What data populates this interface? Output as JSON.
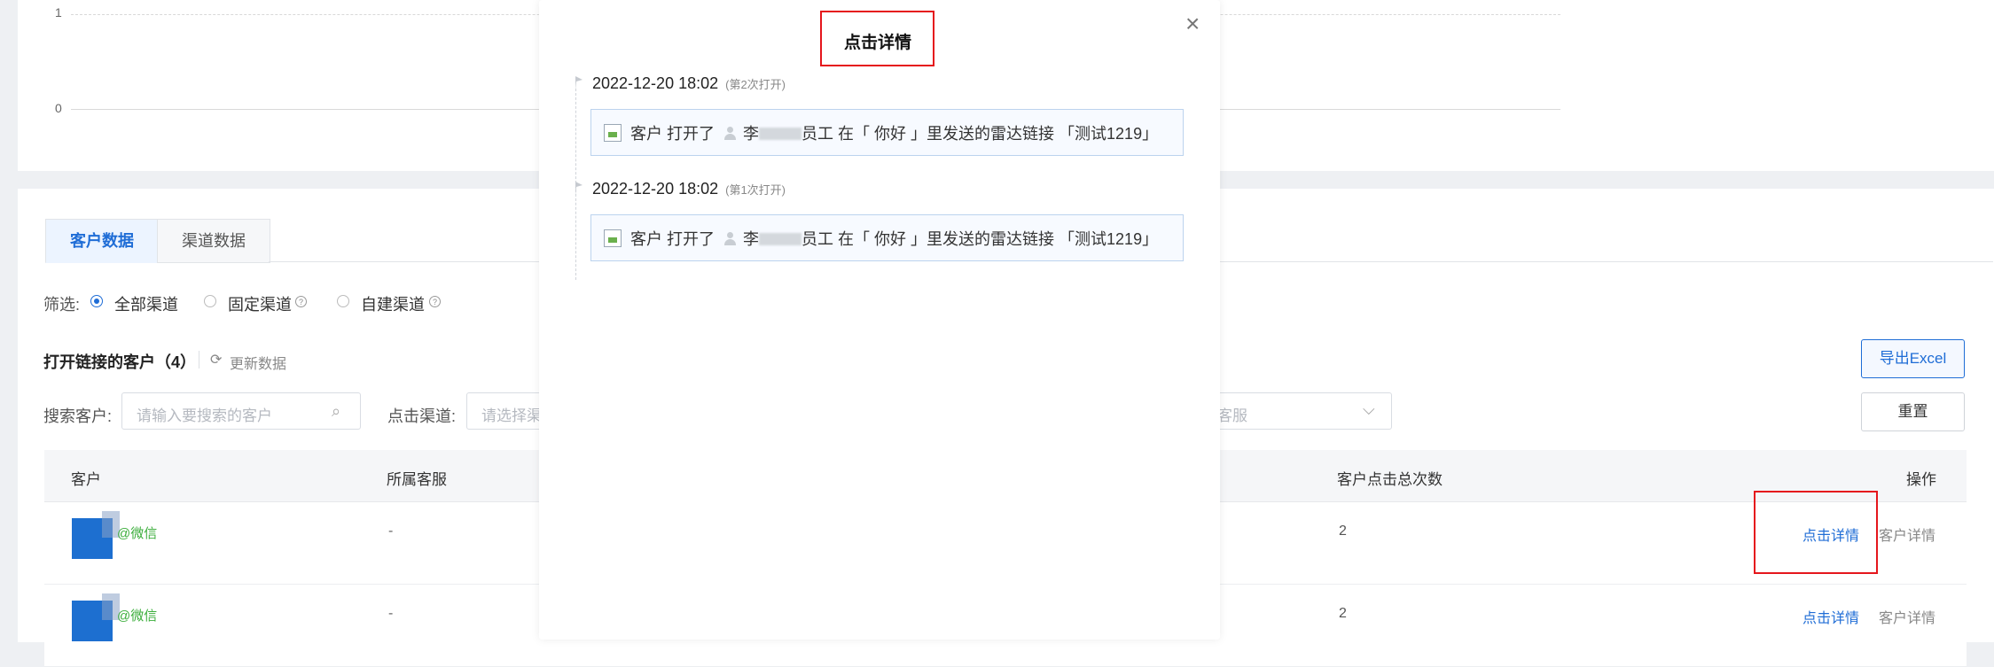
{
  "chart": {
    "ticks": [
      "1",
      "0"
    ]
  },
  "tabs": {
    "customer_data": "客户数据",
    "channel_data": "渠道数据"
  },
  "filter": {
    "label": "筛选:",
    "options": [
      "全部渠道",
      "固定渠道",
      "自建渠道"
    ],
    "selected": "全部渠道"
  },
  "section": {
    "title": "打开链接的客户（4）",
    "refresh": "更新数据",
    "export_button": "导出Excel"
  },
  "search": {
    "customer_label": "搜索客户:",
    "customer_placeholder": "请输入要搜索的客户",
    "channel_label": "点击渠道:",
    "channel_placeholder": "请选择渠",
    "staff_placeholder": "客服",
    "reset_button": "重置"
  },
  "table": {
    "columns": {
      "customer": "客户",
      "staff": "所属客服",
      "clicks": "客户点击总次数",
      "actions": "操作"
    },
    "rows": [
      {
        "tag": "@微信",
        "staff": "-",
        "clicks": "2",
        "detail_link": "点击详情",
        "customer_link": "客户详情"
      },
      {
        "tag": "@微信",
        "staff": "-",
        "clicks": "2",
        "detail_link": "点击详情",
        "customer_link": "客户详情"
      }
    ]
  },
  "modal": {
    "title": "点击详情",
    "close": "×",
    "events": [
      {
        "time": "2022-12-20 18:02",
        "count": "(第2次打开)",
        "prefix": "客户 打开了",
        "name_start": "李",
        "name_end": "员工",
        "suffix": "在「 你好 」里发送的雷达链接 「测试1219」"
      },
      {
        "time": "2022-12-20 18:02",
        "count": "(第1次打开)",
        "prefix": "客户 打开了",
        "name_start": "李",
        "name_end": "员工",
        "suffix": "在「 你好 」里发送的雷达链接 「测试1219」"
      }
    ]
  },
  "colors": {
    "accent": "#1f6dd6",
    "highlight": "#e5161c",
    "wechat_green": "#3cae3c"
  }
}
